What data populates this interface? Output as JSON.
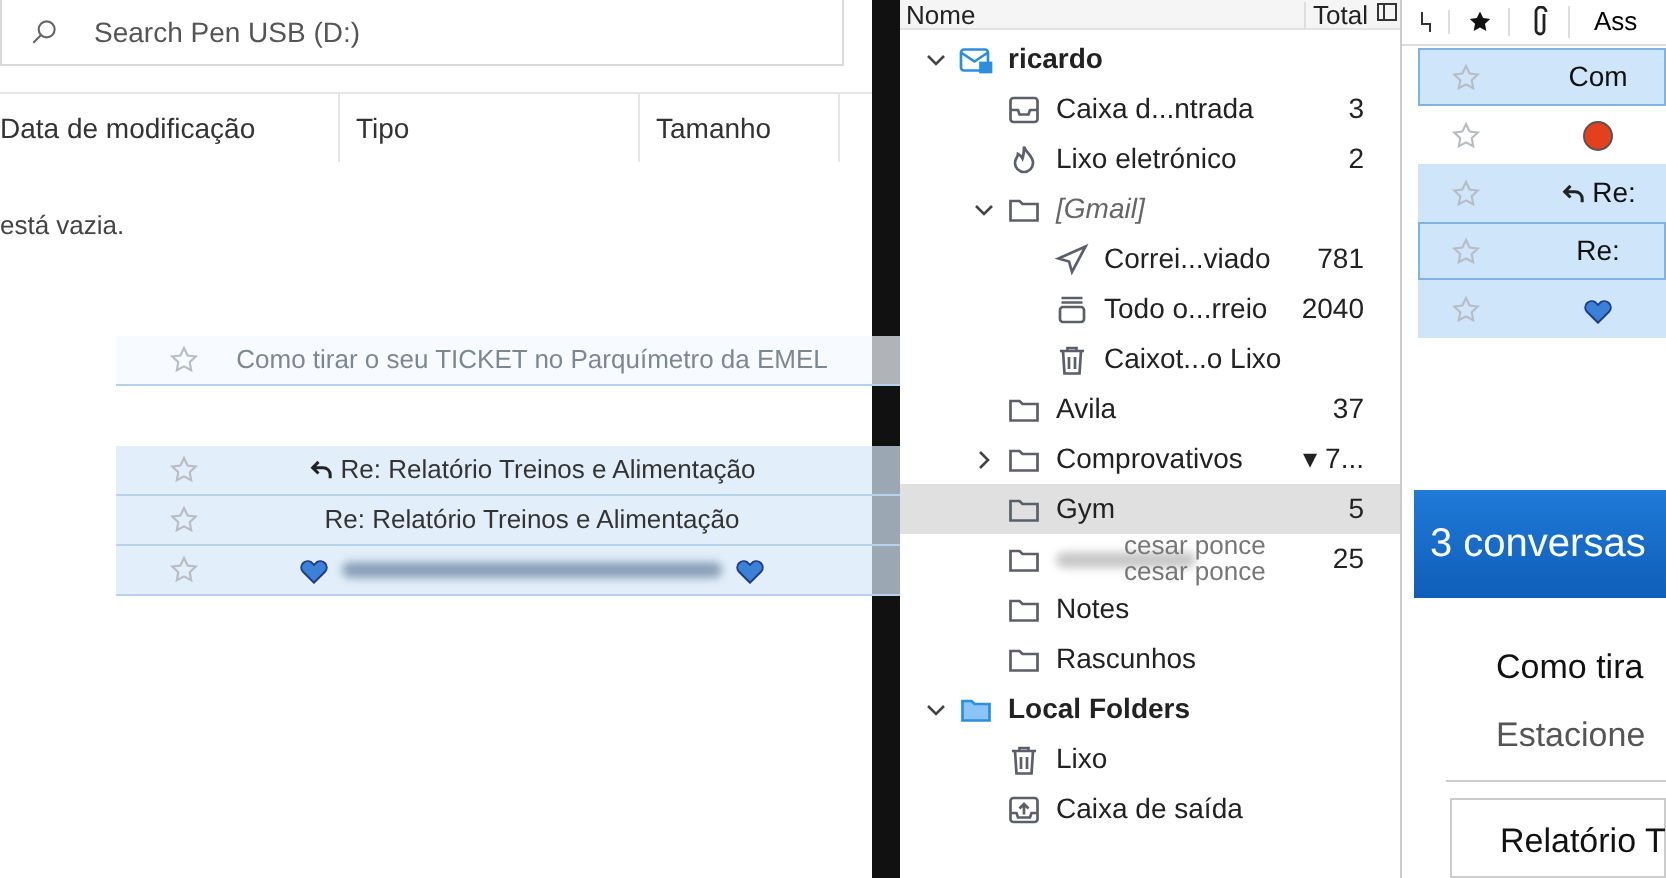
{
  "explorer": {
    "search": {
      "placeholder": "Search Pen USB (D:)"
    },
    "columns": [
      "Data de modificação",
      "Tipo",
      "Tamanho"
    ],
    "empty_message": "está vazia."
  },
  "folder_pane": {
    "columns": [
      "Nome",
      "Total"
    ],
    "folders": [
      {
        "name": "ricardo",
        "kind": "account",
        "expanded": true,
        "selected": false,
        "children": [
          {
            "name": "Caixa d...ntrada",
            "kind": "inbox",
            "count": "3",
            "selected": false
          },
          {
            "name": "Lixo eletrónico",
            "kind": "junk",
            "count": "2",
            "selected": false
          },
          {
            "name": "[Gmail]",
            "kind": "virtual",
            "expanded": true,
            "selected": false,
            "children": [
              {
                "name": "Correi...viado",
                "kind": "sent",
                "count": "781",
                "selected": false
              },
              {
                "name": "Todo o...rreio",
                "kind": "archive",
                "count": "2040",
                "selected": false
              },
              {
                "name": "Caixot...o Lixo",
                "kind": "trash",
                "selected": false
              }
            ]
          },
          {
            "name": "Avila",
            "kind": "folder",
            "count": "37",
            "selected": false
          },
          {
            "name": "Comprovativos",
            "kind": "folder",
            "expanded": false,
            "count": "▾ 7...",
            "selected": false
          },
          {
            "name": "Gym",
            "kind": "folder",
            "count": "5",
            "selected": true
          },
          {
            "kind": "folder",
            "count": "25",
            "selected": false
          },
          {
            "name": "Notes",
            "kind": "folder",
            "selected": false
          },
          {
            "name": "Rascunhos",
            "kind": "folder",
            "selected": false
          }
        ]
      },
      {
        "name": "Local Folders",
        "kind": "local",
        "expanded": true,
        "selected": false,
        "children": [
          {
            "name": "Lixo",
            "kind": "trash",
            "selected": false
          },
          {
            "name": "Caixa de saída",
            "kind": "outbox",
            "selected": false
          }
        ]
      }
    ]
  },
  "thread_pane": {
    "subject_column": "Ass",
    "messages": [
      {
        "kind": "plain",
        "subject": "Com",
        "selected": true,
        "focused": true
      },
      {
        "kind": "dot",
        "selected": false,
        "focused": false
      },
      {
        "kind": "reply",
        "subject": "Re:",
        "selected": true,
        "focused": false
      },
      {
        "kind": "plain",
        "subject": "Re:",
        "selected": true,
        "focused": true
      },
      {
        "kind": "heart",
        "selected": true,
        "focused": false
      }
    ]
  },
  "summary": {
    "title": "3 conversas",
    "subject": "Como tira",
    "preview": "Estacione",
    "card_title": "Relatório T"
  },
  "drag_ghost": [
    {
      "kind": "plain",
      "subject": "Como tirar o seu TICKET no Parquímetro da EMEL",
      "faint": true
    },
    {
      "kind": "reply",
      "subject": "Re: Relatório Treinos e Alimentação",
      "faint": false,
      "sender": "cesar ponce"
    },
    {
      "kind": "plain",
      "subject": "Re: Relatório Treinos e Alimentação",
      "faint": false,
      "sender": "cesar ponce"
    },
    {
      "kind": "heart",
      "faint": false
    }
  ]
}
